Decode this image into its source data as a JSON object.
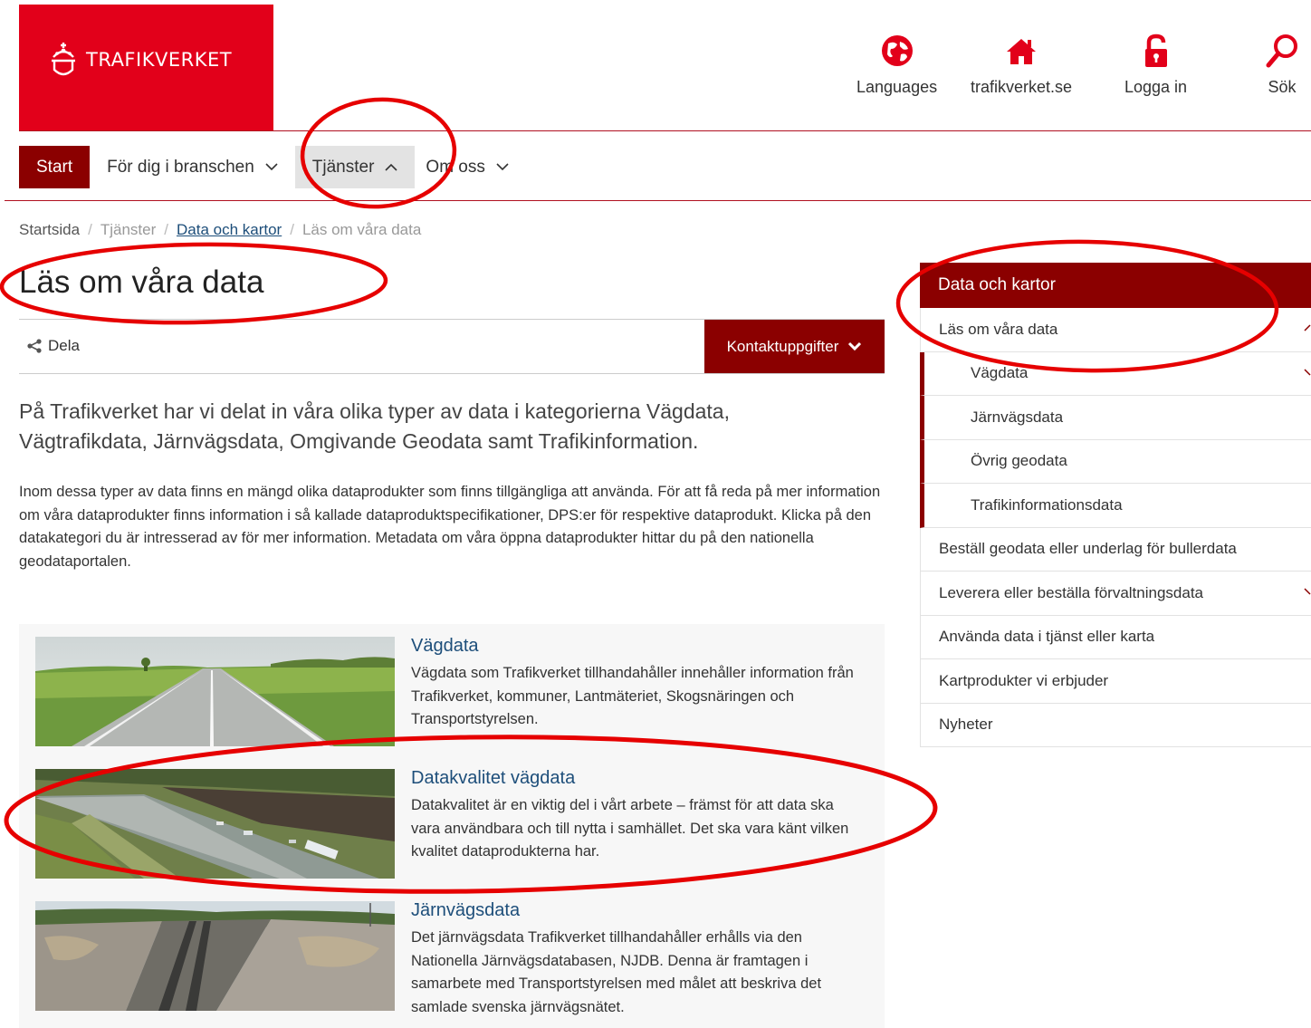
{
  "logo": {
    "text": "TRAFIKVERKET"
  },
  "tools": [
    {
      "label": "Languages",
      "icon": "globe-icon"
    },
    {
      "label": "trafikverket.se",
      "icon": "home-icon"
    },
    {
      "label": "Logga in",
      "icon": "lock-icon"
    },
    {
      "label": "Sök",
      "icon": "search-icon"
    }
  ],
  "nav": {
    "start": "Start",
    "items": [
      "För dig i branschen",
      "Tjänster",
      "Om oss"
    ]
  },
  "breadcrumb": [
    "Startsida",
    "Tjänster",
    "Data och kartor",
    "Läs om våra data"
  ],
  "page": {
    "title": "Läs om våra data",
    "share": "Dela",
    "contact": "Kontaktuppgifter",
    "ingress": "På Trafikverket har vi delat in våra olika typer av data i kategorierna Vägdata, Vägtrafikdata, Järnvägsdata, Omgivande Geodata samt Trafikinformation.",
    "body": "Inom dessa typer av data finns en mängd olika dataprodukter som finns tillgängliga att använda. För att få reda på mer information om våra dataprodukter finns information i så kallade dataproduktspecifikationer, DPS:er för respektive dataprodukt. Klicka på den datakategori du är intresserad av för mer information. Metadata om våra öppna dataprodukter hittar du på den nationella geodataportalen."
  },
  "cards": [
    {
      "title": "Vägdata",
      "desc": "Vägdata som Trafikverket tillhandahåller innehåller information från Trafikverket, kommuner, Lantmäteriet, Skogsnäringen och Transportstyrelsen."
    },
    {
      "title": "Datakvalitet vägdata",
      "desc": "Datakvalitet är en viktig del i vårt arbete – främst för att data ska vara användbara och till nytta i samhället. Det ska vara känt vilken kvalitet dataprodukterna har."
    },
    {
      "title": "Järnvägsdata",
      "desc": "Det järnvägsdata Trafikverket tillhandahåller erhålls via den Nationella Järnvägsdatabasen, NJDB. Denna är framtagen i samarbete med Transportstyrelsen med målet att beskriva det samlade svenska järnvägsnätet."
    }
  ],
  "side": {
    "title": "Data och kartor",
    "items": [
      "Läs om våra data",
      "Vägdata",
      "Järnvägsdata",
      "Övrig geodata",
      "Trafikinformationsdata",
      "Beställ geodata eller underlag för bullerdata",
      "Leverera eller beställa förvaltningsdata",
      "Använda data i tjänst eller karta",
      "Kartprodukter vi erbjuder",
      "Nyheter"
    ]
  },
  "colors": {
    "brand_red": "#e2001a",
    "dark_red": "#8b0000",
    "link": "#1d4e7a",
    "annotation": "#e60000"
  }
}
